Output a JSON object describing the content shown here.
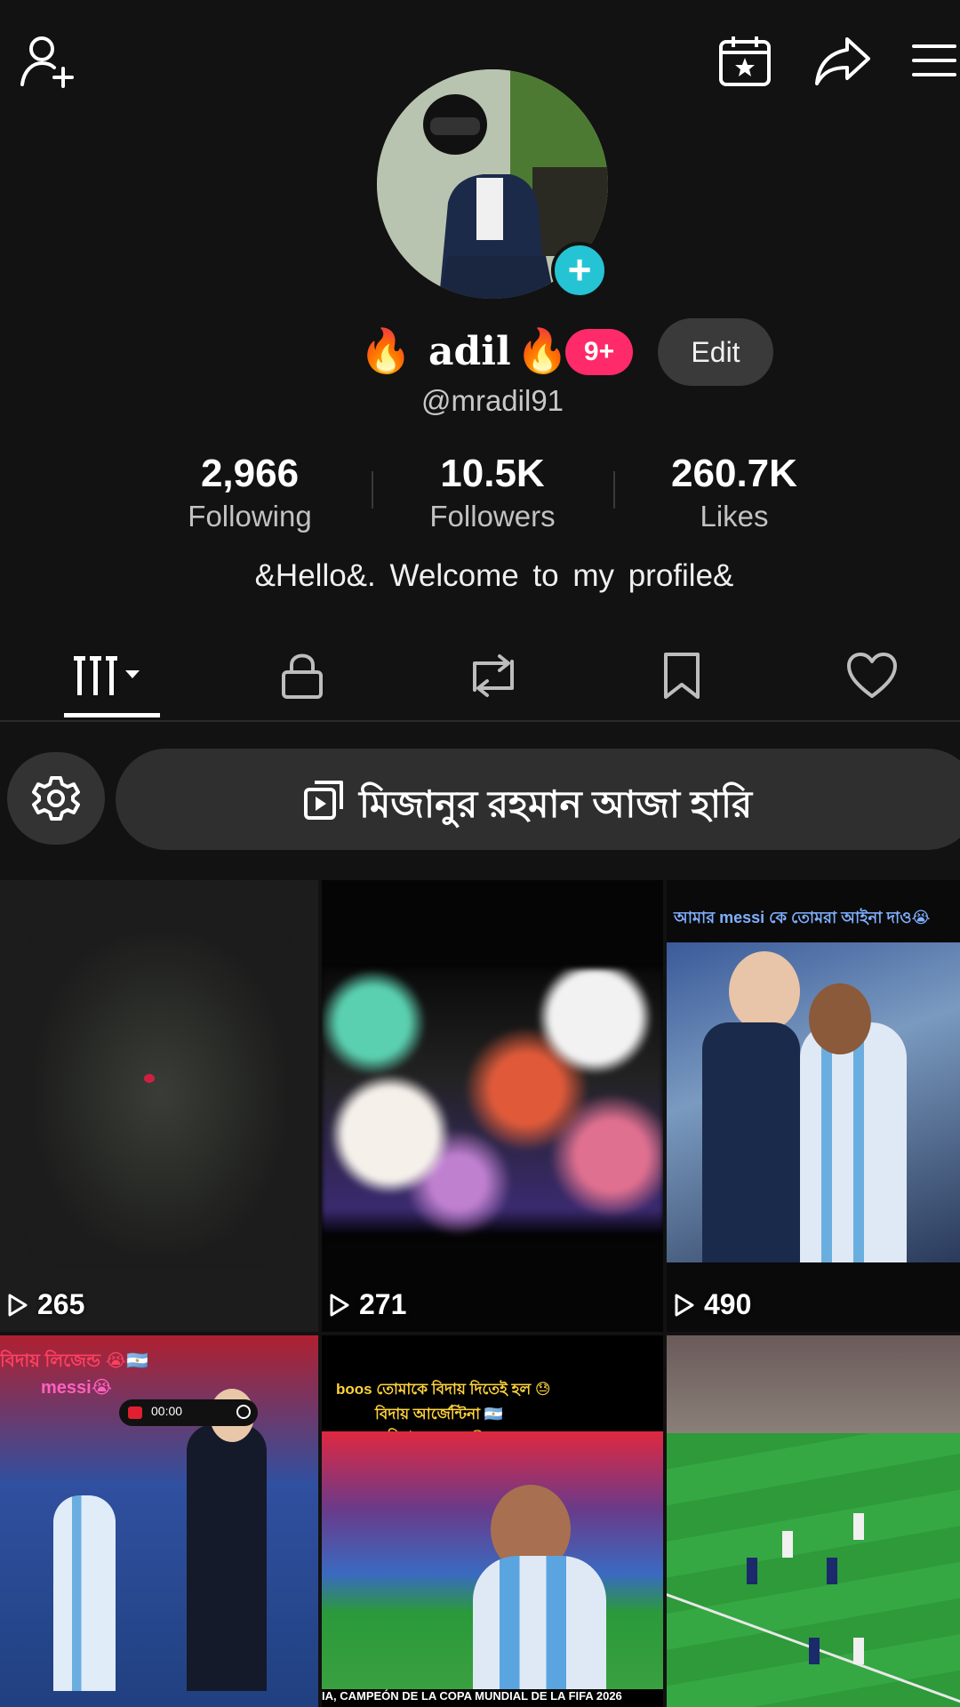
{
  "topbar": {
    "icons": [
      "add-friend-icon",
      "calendar-star-icon",
      "share-icon",
      "menu-icon"
    ]
  },
  "profile": {
    "fire_emoji": "🔥",
    "display_name": "adil",
    "notification_badge": "9+",
    "edit_label": "Edit",
    "username": "@mradil91",
    "avatar_plus": "+"
  },
  "stats": [
    {
      "value": "2,966",
      "label": "Following"
    },
    {
      "value": "10.5K",
      "label": "Followers"
    },
    {
      "value": "260.7K",
      "label": "Likes"
    }
  ],
  "bio": "&Hello&.  Welcome   to  my profile&",
  "tabs": [
    "videos-grid-icon",
    "lock-icon",
    "repost-icon",
    "bookmark-icon",
    "heart-icon"
  ],
  "playlist": {
    "label": "মিজানুর রহমান আজা হারি"
  },
  "videos": [
    {
      "views": "265"
    },
    {
      "views": "271"
    },
    {
      "views": "490",
      "caption": "আমার messi কে তোমরা আইনা দাও😭"
    },
    {
      "caption_line1": "বিদায় লিজেন্ড 😭🇦🇷",
      "caption_line2": "messi😭",
      "timer": "00:00"
    },
    {
      "caption_line1": "boos তোমাকে বিদায় দিতেই হল 😓",
      "caption_line2": "বিদায় আর্জেন্টিনা 🇦🇷",
      "caption_line3": "বিদায় messi😭",
      "footer": "IA, CAMPEÓN DE LA COPA MUNDIAL DE LA FIFA 2026"
    },
    {}
  ],
  "colors": {
    "background": "#121212",
    "accent_cyan": "#25c4d4",
    "badge_pink": "#ff2a6a"
  }
}
